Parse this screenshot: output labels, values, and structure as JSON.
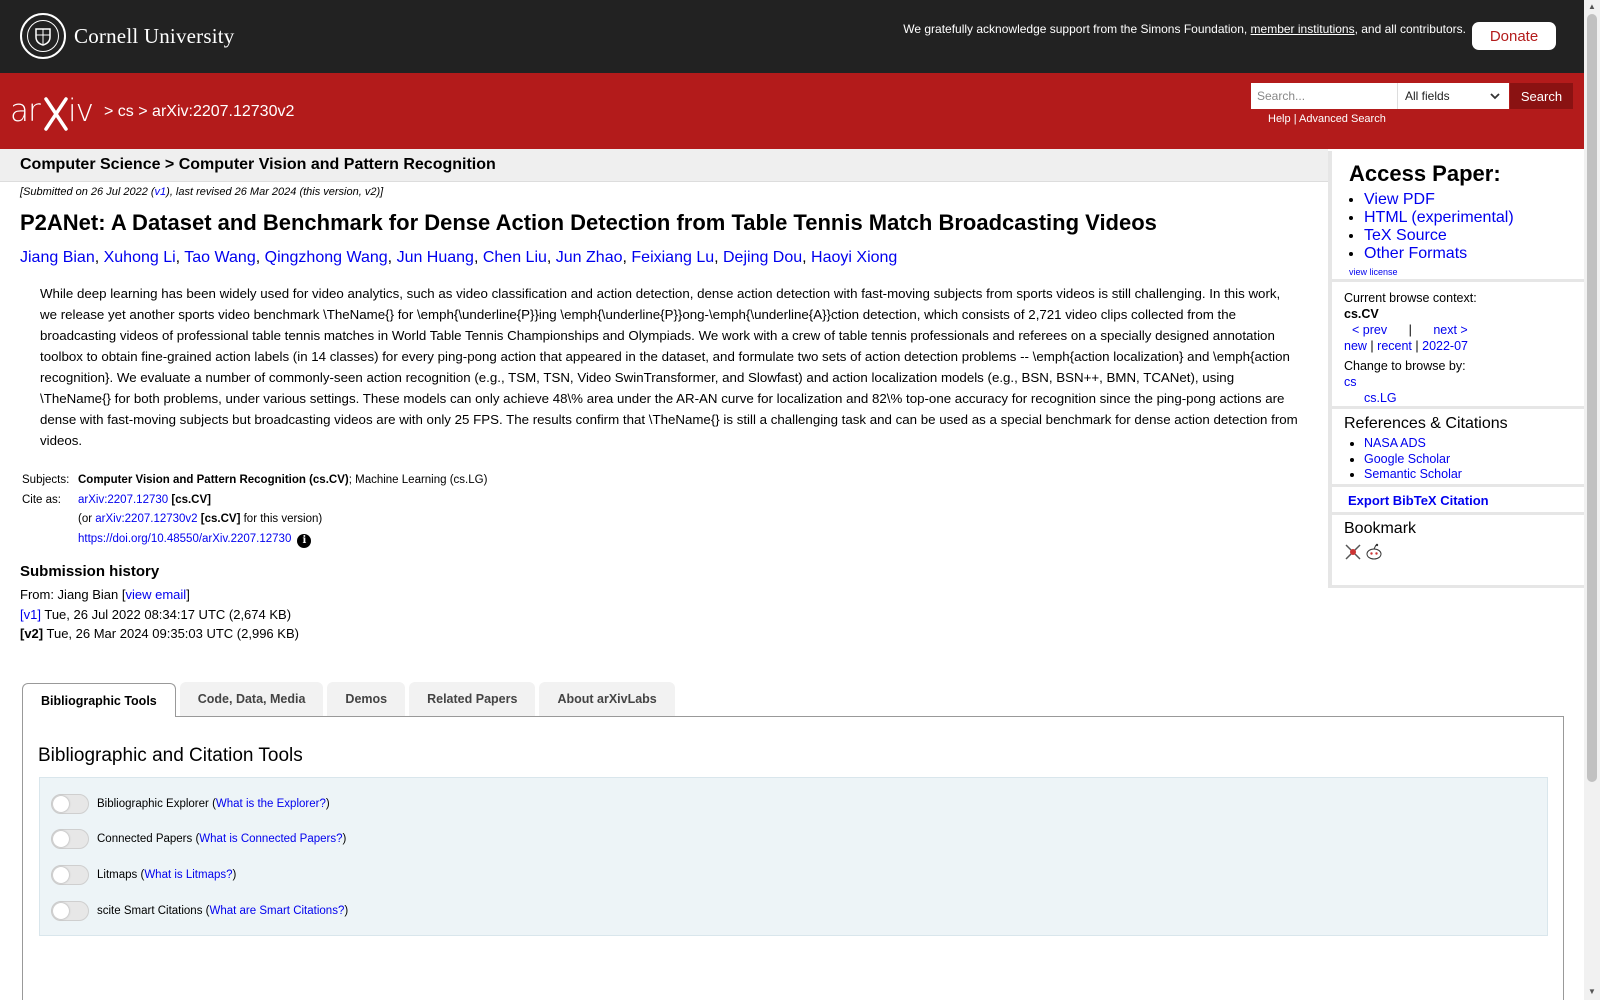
{
  "cornell": {
    "name": "Cornell University",
    "support_text": "We gratefully acknowledge support from the Simons Foundation,",
    "member_link": "member institutions",
    "support_tail": ", and all contributors.",
    "donate": "Donate"
  },
  "header": {
    "logo": "arXiv",
    "crumb_sep1": ">",
    "crumb_cs": "cs",
    "crumb_sep2": ">",
    "crumb_id": "arXiv:2207.12730v2",
    "search_placeholder": "Search...",
    "field_select": "All fields",
    "search_button": "Search",
    "help": "Help",
    "link_sep": "|",
    "advanced": "Advanced Search"
  },
  "subheader": "Computer Science > Computer Vision and Pattern Recognition",
  "paper": {
    "dateline_prefix": "[Submitted on 26 Jul 2022 (",
    "dateline_v1": "v1",
    "dateline_suffix": "), last revised 26 Mar 2024 (this version, v2)]",
    "title": "P2ANet: A Dataset and Benchmark for Dense Action Detection from Table Tennis Match Broadcasting Videos",
    "authors": [
      "Jiang Bian",
      "Xuhong Li",
      "Tao Wang",
      "Qingzhong Wang",
      "Jun Huang",
      "Chen Liu",
      "Jun Zhao",
      "Feixiang Lu",
      "Dejing Dou",
      "Haoyi Xiong"
    ],
    "abstract": "While deep learning has been widely used for video analytics, such as video classification and action detection, dense action detection with fast-moving subjects from sports videos is still challenging. In this work, we release yet another sports video benchmark \\TheName{} for \\emph{\\underline{P}}ing \\emph{\\underline{P}}ong-\\emph{\\underline{A}}ction detection, which consists of 2,721 video clips collected from the broadcasting videos of professional table tennis matches in World Table Tennis Championships and Olympiads. We work with a crew of table tennis professionals and referees on a specially designed annotation toolbox to obtain fine-grained action labels (in 14 classes) for every ping-pong action that appeared in the dataset, and formulate two sets of action detection problems -- \\emph{action localization} and \\emph{action recognition}. We evaluate a number of commonly-seen action recognition (e.g., TSM, TSN, Video SwinTransformer, and Slowfast) and action localization models (e.g., BSN, BSN++, BMN, TCANet), using \\TheName{} for both problems, under various settings. These models can only achieve 48\\% area under the AR-AN curve for localization and 82\\% top-one accuracy for recognition since the ping-pong actions are dense with fast-moving subjects but broadcasting videos are with only 25 FPS. The results confirm that \\TheName{} is still a challenging task and can be used as a special benchmark for dense action detection from videos.",
    "subjects_label": "Subjects:",
    "subjects_primary": "Computer Vision and Pattern Recognition (cs.CV)",
    "subjects_rest": "; Machine Learning (cs.LG)",
    "cite_label": "Cite as:",
    "cite_id": "arXiv:2207.12730",
    "cite_cat": "[cs.CV]",
    "cite_or": "(or",
    "cite_v2": "arXiv:2207.12730v2",
    "cite_v2_cat": "[cs.CV]",
    "cite_v2_tail": "for this version)",
    "doi": "https://doi.org/10.48550/arXiv.2207.12730",
    "info_glyph": "i"
  },
  "history": {
    "title": "Submission history",
    "from_prefix": "From: Jiang Bian [",
    "view_email": "view email",
    "from_suffix": "]",
    "v1_label": "[v1]",
    "v1_text": "Tue, 26 Jul 2022 08:34:17 UTC (2,674 KB)",
    "v2_label": "[v2]",
    "v2_text": "Tue, 26 Mar 2024 09:35:03 UTC (2,996 KB)"
  },
  "tabs": [
    "Bibliographic Tools",
    "Code, Data, Media",
    "Demos",
    "Related Papers",
    "About arXivLabs"
  ],
  "tools": {
    "title": "Bibliographic and Citation Tools",
    "items": [
      {
        "label": "Bibliographic Explorer",
        "link": "What is the Explorer?"
      },
      {
        "label": "Connected Papers",
        "link": "What is Connected Papers?"
      },
      {
        "label": "Litmaps",
        "link": "What is Litmaps?"
      },
      {
        "label": "scite Smart Citations",
        "link": "What are Smart Citations?"
      }
    ]
  },
  "sidebar": {
    "access_title": "Access Paper:",
    "access_links": [
      "View PDF",
      "HTML (experimental)",
      "TeX Source",
      "Other Formats"
    ],
    "view_license": "view license",
    "context_label": "Current browse context:",
    "context_value": "cs.CV",
    "prev": "< prev",
    "nav_sep": "|",
    "next": "next >",
    "new": "new",
    "recent": "recent",
    "month": "2022-07",
    "change_label": "Change to browse by:",
    "browse_cs": "cs",
    "browse_lg": "cs.LG",
    "refs_title": "References & Citations",
    "refs": [
      "NASA ADS",
      "Google Scholar",
      "Semantic Scholar"
    ],
    "export_bibtex": "Export BibTeX Citation",
    "bookmark_title": "Bookmark"
  },
  "colors": {
    "arxiv_red": "#b31b1b",
    "cornell_dark": "#222222",
    "link_blue": "#0000ee"
  }
}
